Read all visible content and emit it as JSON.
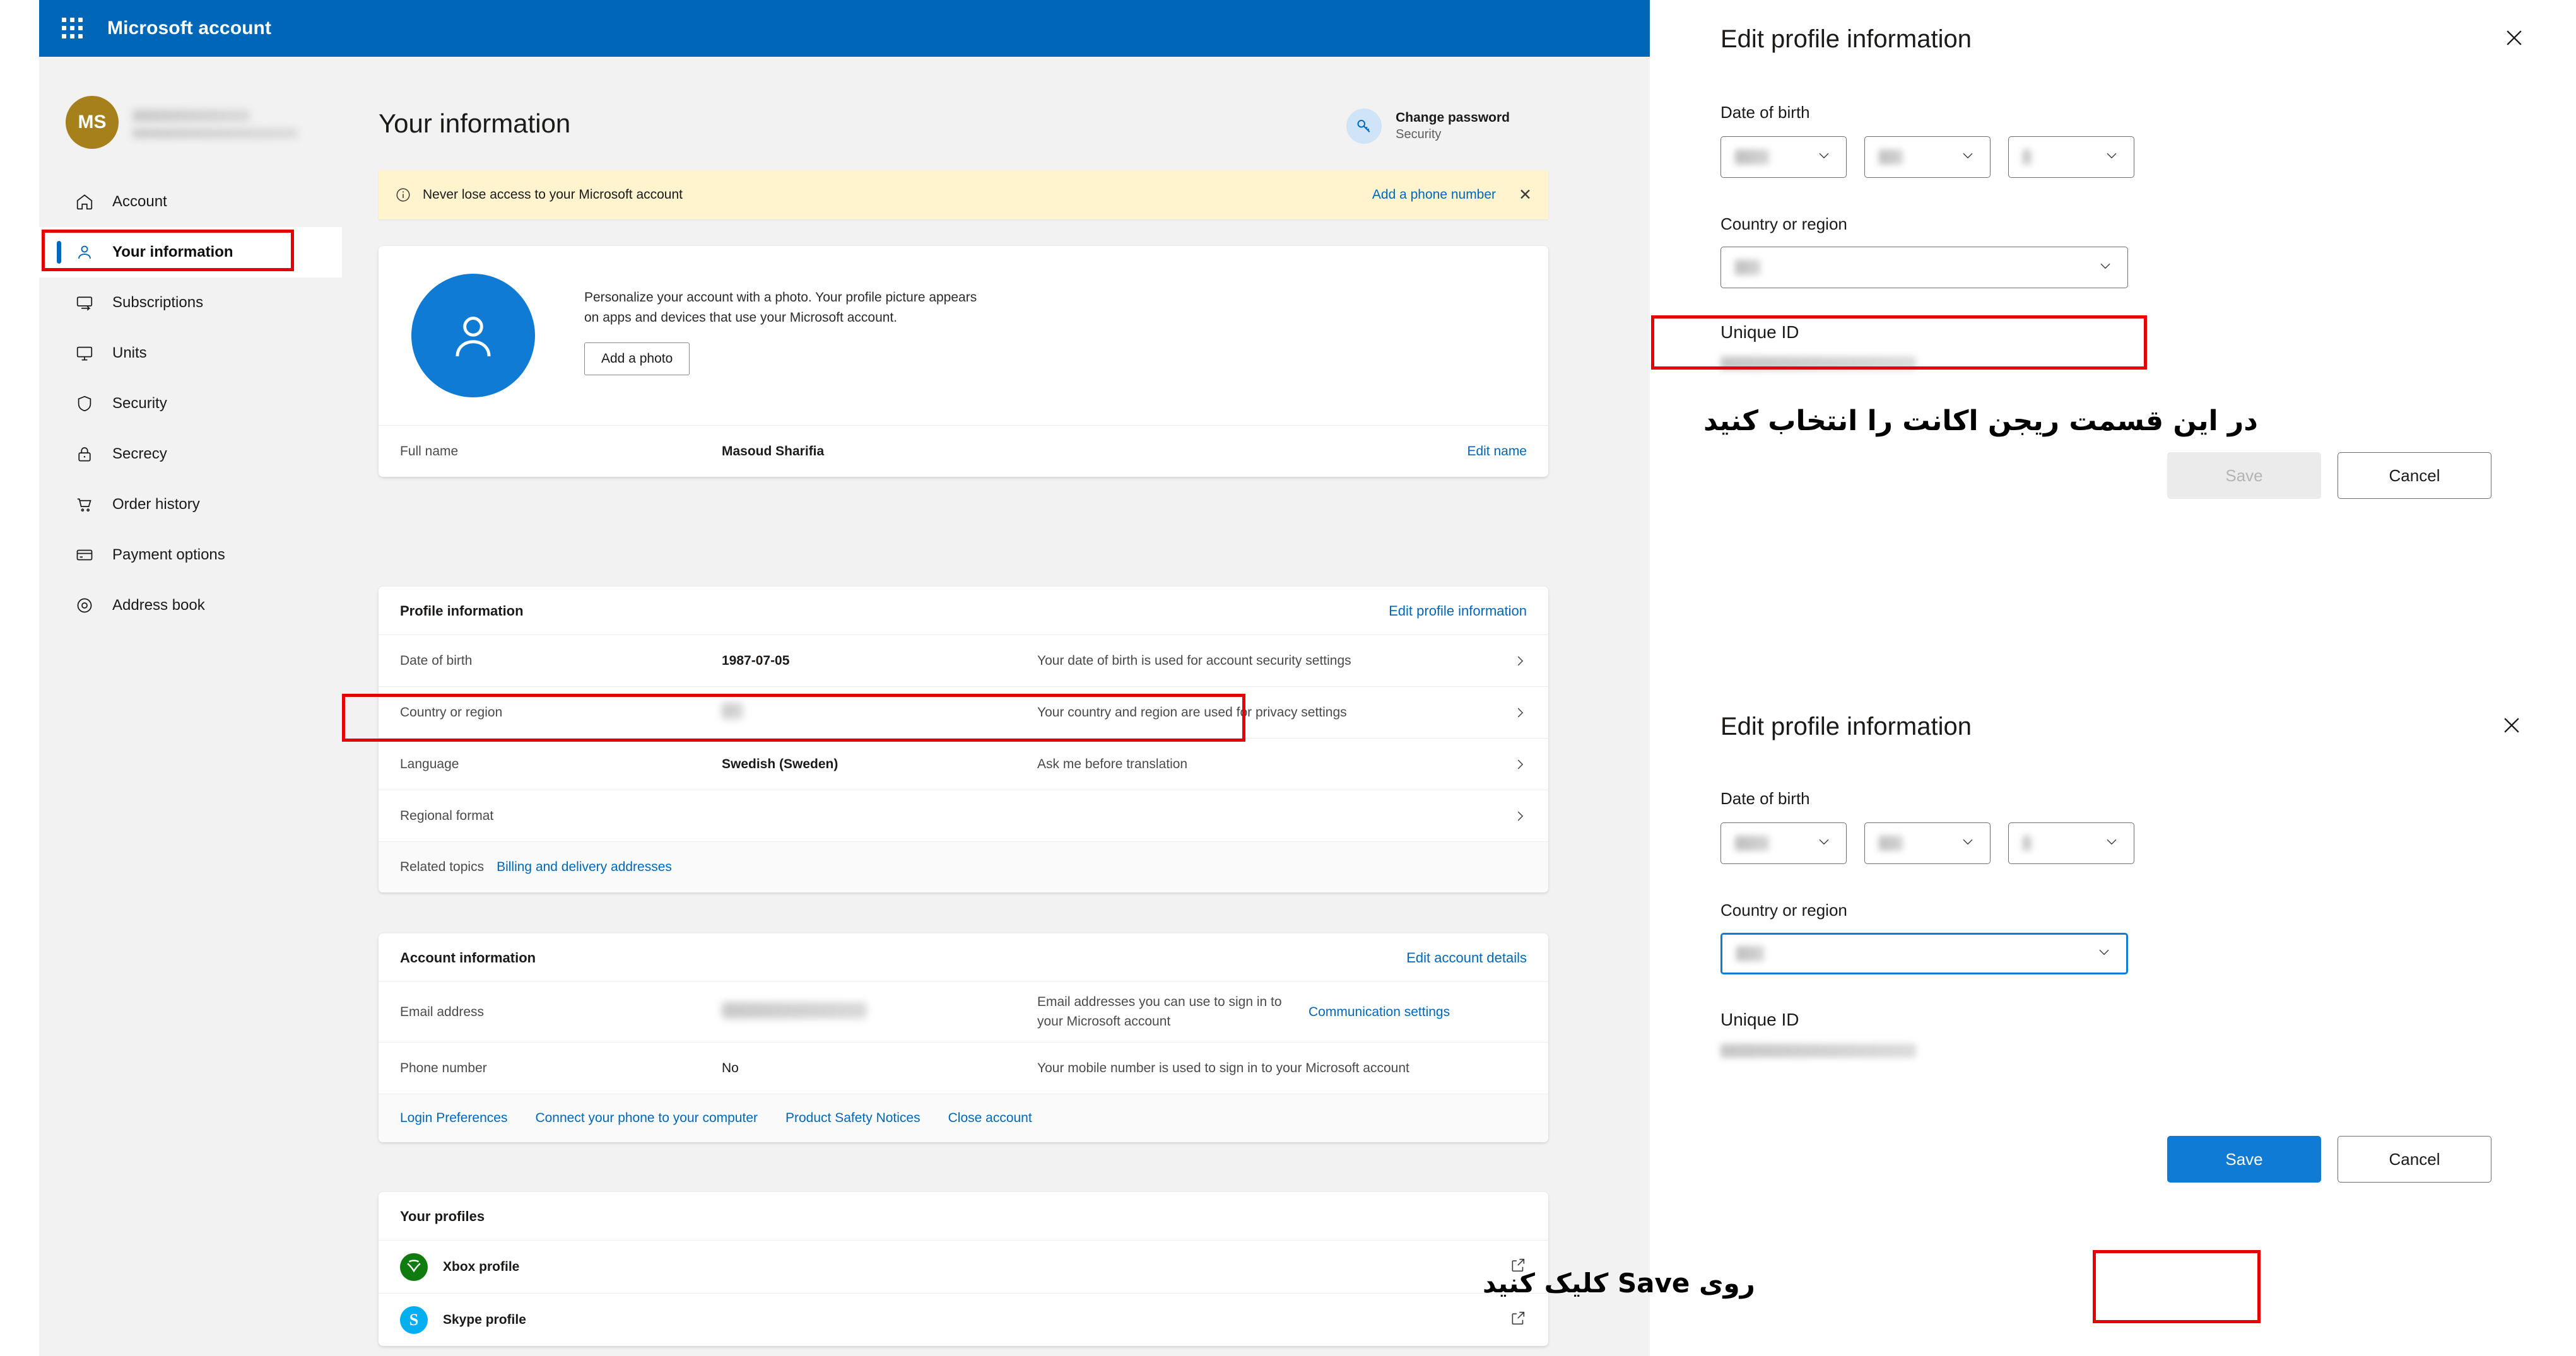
{
  "topbar": {
    "title": "Microsoft account",
    "waffle_icon": "waffle-grid-icon",
    "brand_color": "#0067b8"
  },
  "sidebar": {
    "avatar_initials": "MS",
    "avatar_color": "#a6801a",
    "items": [
      {
        "label": "Account",
        "icon": "home-icon"
      },
      {
        "label": "Your information",
        "icon": "person-icon"
      },
      {
        "label": "Subscriptions",
        "icon": "subscriptions-icon"
      },
      {
        "label": "Units",
        "icon": "monitor-icon"
      },
      {
        "label": "Security",
        "icon": "shield-icon"
      },
      {
        "label": "Secrecy",
        "icon": "lock-icon"
      },
      {
        "label": "Order history",
        "icon": "cart-icon"
      },
      {
        "label": "Payment options",
        "icon": "credit-card-icon"
      },
      {
        "label": "Address book",
        "icon": "location-icon"
      }
    ],
    "active_index": 1
  },
  "main": {
    "page_title": "Your information",
    "change_password": {
      "title": "Change password",
      "subtitle": "Security",
      "icon": "key-icon"
    },
    "banner": {
      "icon": "info-icon",
      "text": "Never lose access to your Microsoft account",
      "link": "Add a phone number",
      "close_icon": "close-icon"
    },
    "photo_card": {
      "avatar_icon": "person-avatar-icon",
      "description": "Personalize your account with a photo. Your profile picture appears on apps and devices that use your Microsoft account.",
      "button": "Add a photo",
      "full_name_label": "Full name",
      "full_name_value": "Masoud Sharifia",
      "edit_name_link": "Edit name"
    },
    "profile_card": {
      "title": "Profile information",
      "edit_link": "Edit profile information",
      "rows": [
        {
          "label": "Date of birth",
          "value": "1987-07-05",
          "desc": "Your date of birth is used for account security settings",
          "blurred": false
        },
        {
          "label": "Country or region",
          "value": "",
          "desc": "Your country and region are used for privacy settings",
          "blurred": true
        },
        {
          "label": "Language",
          "value": "Swedish (Sweden)",
          "desc": "Ask me before translation",
          "blurred": false
        },
        {
          "label": "Regional format",
          "value": "",
          "desc": "",
          "blurred": false
        }
      ],
      "related_label": "Related topics",
      "related_link": "Billing and delivery addresses"
    },
    "account_card": {
      "title": "Account information",
      "edit_link": "Edit account details",
      "email_label": "Email address",
      "email_desc": "Email addresses you can use to sign in to your Microsoft account",
      "email_link": "Communication settings",
      "phone_label": "Phone number",
      "phone_value": "No",
      "phone_desc": "Your mobile number is used to sign in to your Microsoft account",
      "footer_links": [
        "Login Preferences",
        "Connect your phone to your computer",
        "Product Safety Notices",
        "Close account"
      ]
    },
    "profiles_card": {
      "title": "Your profiles",
      "items": [
        {
          "label": "Xbox profile",
          "icon": "xbox-icon",
          "color": "#107c10",
          "ext_icon": "external-link-icon"
        },
        {
          "label": "Skype profile",
          "icon": "skype-icon",
          "color": "#00aff0",
          "ext_icon": "external-link-icon"
        }
      ]
    }
  },
  "dialogs": [
    {
      "title": "Edit profile information",
      "close_icon": "close-icon",
      "dob_label": "Date of birth",
      "dob_fields": [
        "",
        "",
        ""
      ],
      "country_label": "Country or region",
      "country_value": "",
      "country_focused": false,
      "country_highlighted": true,
      "uid_label": "Unique ID",
      "uid_value": "",
      "save_label": "Save",
      "save_enabled": false,
      "cancel_label": "Cancel",
      "save_highlighted": false,
      "annotation": "در این قسمت ریجن اکانت را انتخاب کنید"
    },
    {
      "title": "Edit profile information",
      "close_icon": "close-icon",
      "dob_label": "Date of birth",
      "dob_fields": [
        "",
        "",
        ""
      ],
      "country_label": "Country or region",
      "country_value": "",
      "country_focused": true,
      "country_highlighted": false,
      "uid_label": "Unique ID",
      "uid_value": "",
      "save_label": "Save",
      "save_enabled": true,
      "cancel_label": "Cancel",
      "save_highlighted": true,
      "annotation": "روی Save کلیک کنید"
    }
  ],
  "highlight_color": "#e60000",
  "accent_color": "#0067b8"
}
